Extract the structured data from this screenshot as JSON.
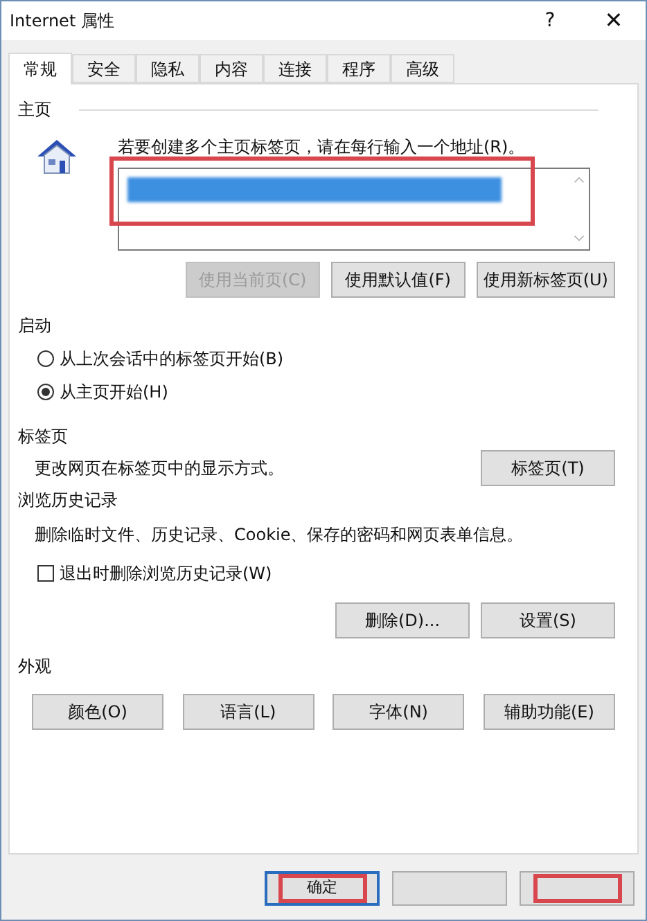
{
  "window": {
    "title": "Internet 属性",
    "help": "?",
    "close": "✕"
  },
  "tabs": [
    {
      "label": "常规",
      "selected": true
    },
    {
      "label": "安全",
      "selected": false
    },
    {
      "label": "隐私",
      "selected": false
    },
    {
      "label": "内容",
      "selected": false
    },
    {
      "label": "连接",
      "selected": false
    },
    {
      "label": "程序",
      "selected": false
    },
    {
      "label": "高级",
      "selected": false
    }
  ],
  "home": {
    "heading": "主页",
    "hint": "若要创建多个主页标签页，请在每行输入一个地址(R)。",
    "address_redacted": true,
    "address_highlighted": true,
    "buttons": [
      {
        "label": "使用当前页(C)",
        "disabled": true
      },
      {
        "label": "使用默认值(F)",
        "disabled": false
      },
      {
        "label": "使用新标签页(U)",
        "disabled": false
      }
    ]
  },
  "startup": {
    "heading": "启动",
    "options": [
      {
        "label": "从上次会话中的标签页开始(B)",
        "selected": false
      },
      {
        "label": "从主页开始(H)",
        "selected": true
      }
    ]
  },
  "tabs_section": {
    "heading": "标签页",
    "text": "更改网页在标签页中的显示方式。",
    "button": "标签页(T)"
  },
  "history": {
    "heading": "浏览历史记录",
    "text": "删除临时文件、历史记录、Cookie、保存的密码和网页表单信息。",
    "checkbox": {
      "label": "退出时删除浏览历史记录(W)",
      "checked": false
    },
    "buttons": [
      "删除(D)...",
      "设置(S)"
    ]
  },
  "appearance": {
    "heading": "外观",
    "buttons": [
      "颜色(O)",
      "语言(L)",
      "字体(N)",
      "辅助功能(E)"
    ]
  },
  "bottom_buttons": [
    {
      "label": "确定",
      "default": true,
      "highlighted": true
    },
    {
      "default": false,
      "highlighted": false
    },
    {
      "default": false,
      "highlighted": true
    }
  ]
}
